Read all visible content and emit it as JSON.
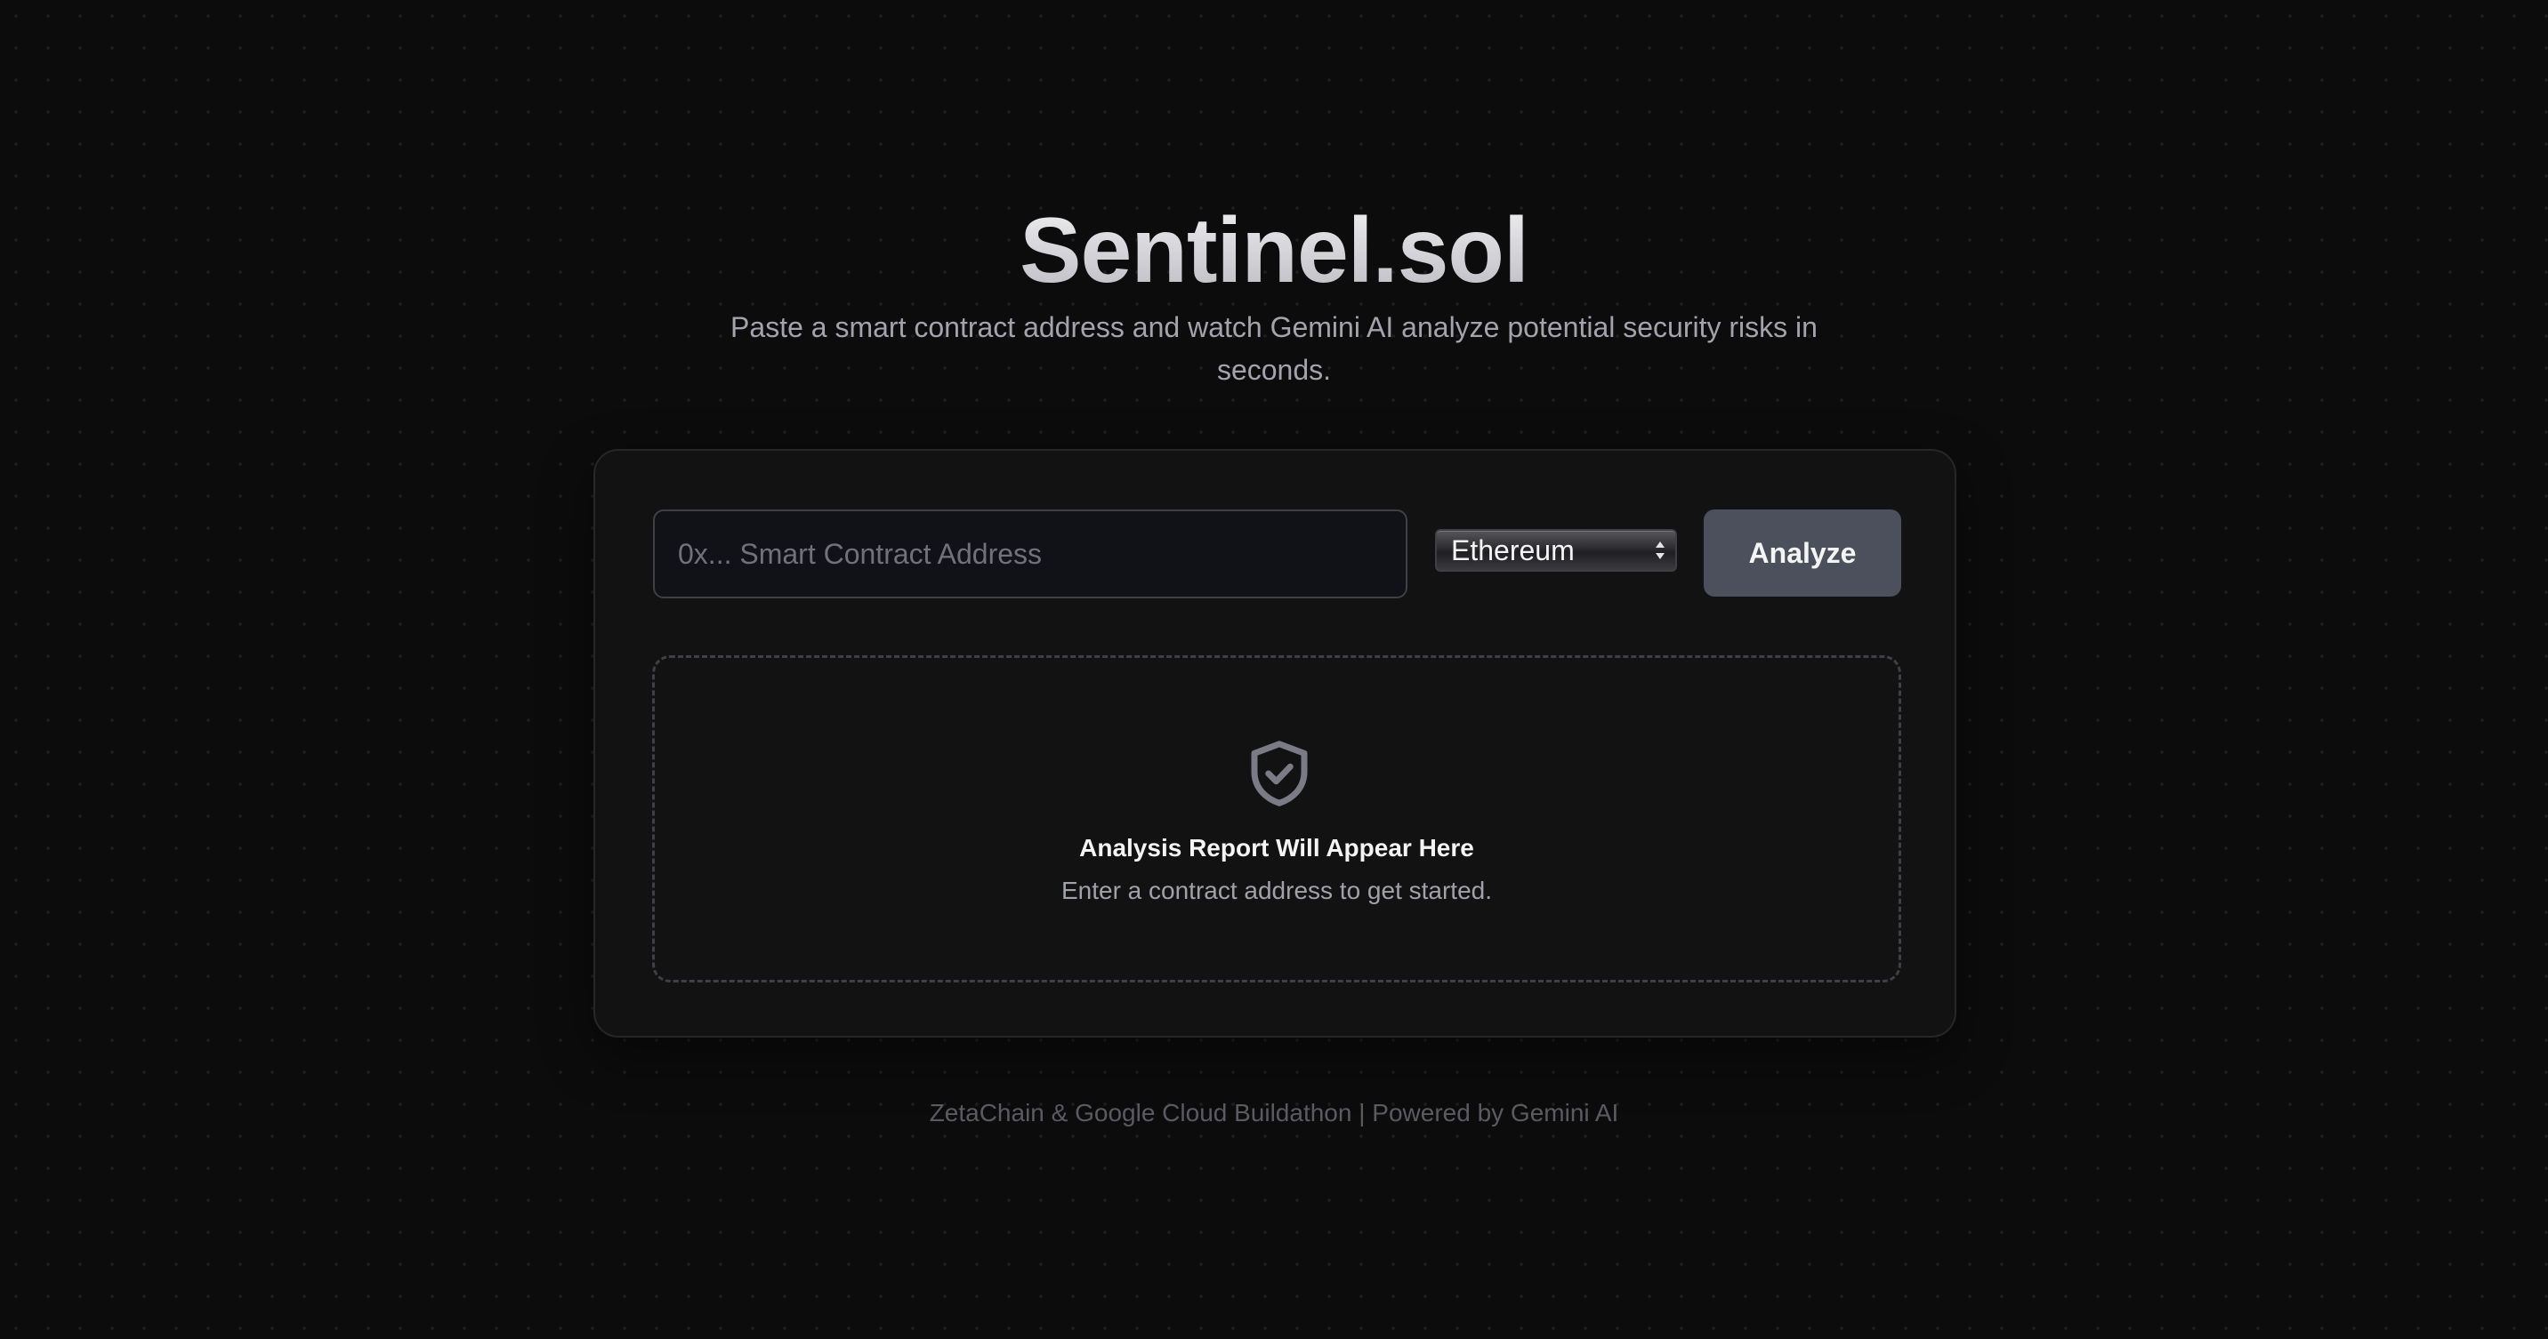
{
  "header": {
    "title": "Sentinel.sol",
    "subtitle": "Paste a smart contract address and watch Gemini AI analyze potential security risks in seconds."
  },
  "form": {
    "address_placeholder": "0x... Smart Contract Address",
    "address_value": "",
    "network_selected": "Ethereum",
    "analyze_label": "Analyze"
  },
  "report": {
    "icon": "shield-check-icon",
    "title": "Analysis Report Will Appear Here",
    "hint": "Enter a contract address to get started."
  },
  "footer": {
    "text": "ZetaChain & Google Cloud Buildathon | Powered by Gemini AI"
  },
  "colors": {
    "background": "#0c0c0d",
    "card": "#121213",
    "button": "#4b505c",
    "input_background": "#101217"
  }
}
